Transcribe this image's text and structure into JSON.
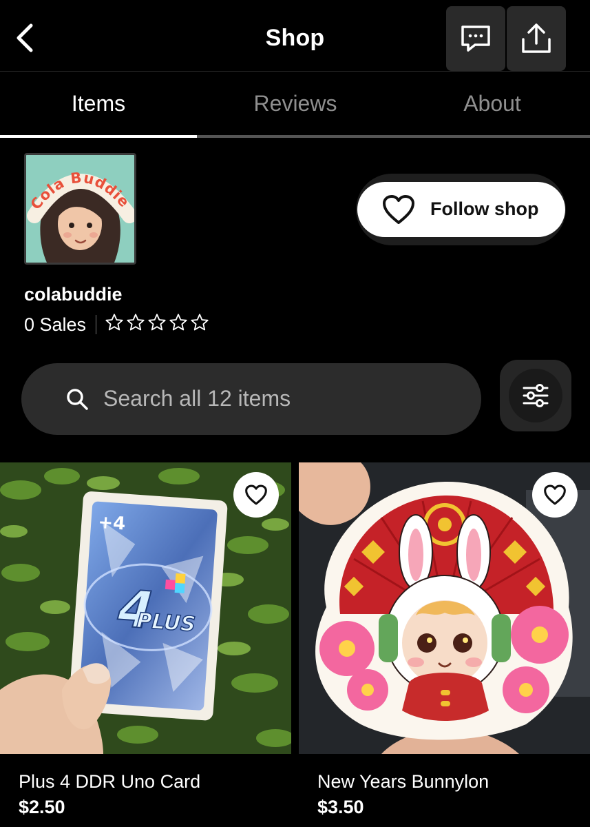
{
  "header": {
    "title": "Shop",
    "back_icon": "chevron-left-icon",
    "message_icon": "chat-bubble-icon",
    "share_icon": "share-icon"
  },
  "tabs": [
    {
      "label": "Items",
      "active": true
    },
    {
      "label": "Reviews",
      "active": false
    },
    {
      "label": "About",
      "active": false
    }
  ],
  "shop": {
    "name": "colabuddie",
    "sales": "0 Sales",
    "rating": 0,
    "rating_max": 5,
    "logo_text": "Cola Buddie",
    "follow_label": "Follow shop"
  },
  "search": {
    "placeholder": "Search all 12 items"
  },
  "listings": [
    {
      "title": "Plus 4 DDR Uno Card",
      "price": "$2.50",
      "card_corner": "+4",
      "card_brand": "PLUS",
      "card_digit": "4"
    },
    {
      "title": "New Years Bunnylon",
      "price": "$3.50"
    }
  ],
  "colors": {
    "background": "#000000",
    "tab_indicator": "#ffffff",
    "search_bg": "#2c2c2c",
    "logo_bg": "#8ecfbf",
    "logo_text": "#e8503a"
  }
}
